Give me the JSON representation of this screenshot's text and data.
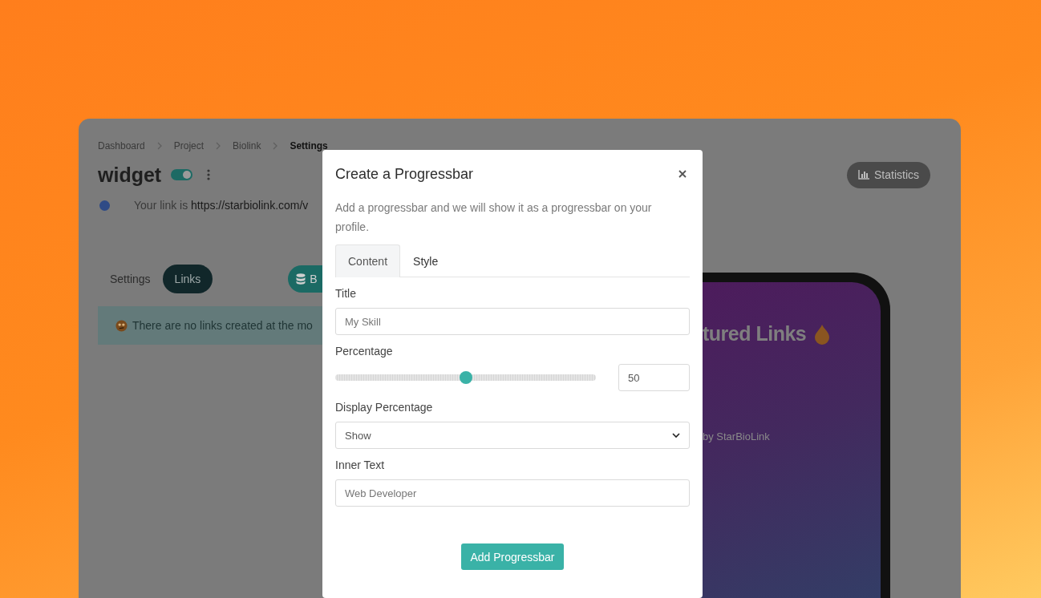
{
  "breadcrumb": [
    {
      "label": "Dashboard",
      "current": false
    },
    {
      "label": "Project",
      "current": false
    },
    {
      "label": "Biolink",
      "current": false
    },
    {
      "label": "Settings",
      "current": true
    }
  ],
  "page": {
    "title": "widget",
    "enabled": true,
    "link_prefix": "Your link is",
    "link_url": "https://starbiolink.com/v",
    "statistics_button": "Statistics"
  },
  "tabs": [
    {
      "label": "Settings",
      "selected": false
    },
    {
      "label": "Links",
      "selected": true
    }
  ],
  "action_button": "B",
  "alert": "There are no links created at the mo",
  "preview": {
    "heading": "tured Links",
    "footer": "by StarBioLink"
  },
  "modal": {
    "title": "Create a Progressbar",
    "description": "Add a progressbar and we will show it as a progressbar on your profile.",
    "tabs": [
      {
        "label": "Content",
        "selected": true
      },
      {
        "label": "Style",
        "selected": false
      }
    ],
    "fields": [
      {
        "kind": "text",
        "label": "Title",
        "placeholder": "My Skill"
      },
      {
        "kind": "slider",
        "label": "Percentage",
        "level": 0.5,
        "value": "50"
      },
      {
        "kind": "select",
        "label": "Display Percentage",
        "value": "Show"
      },
      {
        "kind": "text",
        "label": "Inner Text",
        "placeholder": "Web Developer"
      }
    ],
    "submit": "Add Progressbar"
  }
}
